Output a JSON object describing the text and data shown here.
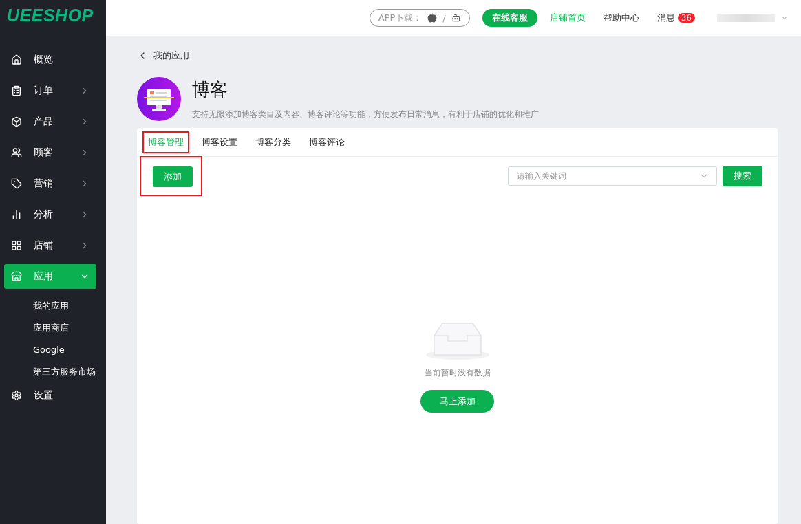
{
  "logo": "UEESHOP",
  "sidebar": {
    "items": [
      {
        "label": "概览",
        "has_children": false,
        "expanded": false,
        "selected": false
      },
      {
        "label": "订单",
        "has_children": true,
        "expanded": false,
        "selected": false
      },
      {
        "label": "产品",
        "has_children": true,
        "expanded": false,
        "selected": false
      },
      {
        "label": "顾客",
        "has_children": true,
        "expanded": false,
        "selected": false
      },
      {
        "label": "营销",
        "has_children": true,
        "expanded": false,
        "selected": false
      },
      {
        "label": "分析",
        "has_children": true,
        "expanded": false,
        "selected": false
      },
      {
        "label": "店铺",
        "has_children": true,
        "expanded": false,
        "selected": false
      },
      {
        "label": "应用",
        "has_children": true,
        "expanded": true,
        "selected": true,
        "children": [
          {
            "label": "我的应用"
          },
          {
            "label": "应用商店"
          },
          {
            "label": "Google"
          },
          {
            "label": "第三方服务市场"
          }
        ]
      },
      {
        "label": "设置",
        "has_children": false,
        "expanded": false,
        "selected": false
      }
    ]
  },
  "topbar": {
    "app_download": "APP下载：",
    "separator": "/",
    "online_service": "在线客服",
    "links": [
      {
        "label": "店铺首页",
        "selected": true
      },
      {
        "label": "帮助中心",
        "selected": false
      }
    ],
    "messages": "消息",
    "message_count": "36"
  },
  "breadcrumb": "我的应用",
  "app": {
    "title": "博客",
    "description": "支持无限添加博客类目及内容、博客评论等功能，方便发布日常消息，有利于店铺的优化和推广"
  },
  "tabs": [
    {
      "label": "博客管理",
      "selected": true,
      "highlighted": true
    },
    {
      "label": "博客设置",
      "selected": false,
      "highlighted": false
    },
    {
      "label": "博客分类",
      "selected": false,
      "highlighted": false
    },
    {
      "label": "博客评论",
      "selected": false,
      "highlighted": false
    }
  ],
  "toolbar": {
    "add_button": "添加",
    "add_highlighted": true,
    "search": {
      "placeholder": "请输入关键词"
    },
    "search_button": "搜索"
  },
  "empty": {
    "message": "当前暂时没有数据",
    "button": "马上添加"
  }
}
